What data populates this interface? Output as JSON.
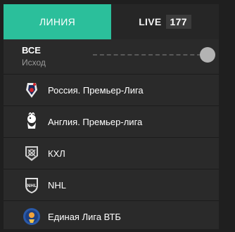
{
  "tabs": {
    "line_label": "ЛИНИЯ",
    "live_label": "LIVE",
    "live_count": "177"
  },
  "filter": {
    "title": "ВСЕ",
    "subtitle": "Исход"
  },
  "leagues": [
    {
      "name": "Россия. Премьер-Лига",
      "icon": "russian-premier-league-icon"
    },
    {
      "name": "Англия. Премьер-лига",
      "icon": "english-premier-league-icon"
    },
    {
      "name": "КХЛ",
      "icon": "khl-icon"
    },
    {
      "name": "NHL",
      "icon": "nhl-icon"
    },
    {
      "name": "Единая Лига ВТБ",
      "icon": "vtb-united-league-icon"
    }
  ],
  "colors": {
    "accent": "#2bbf9b",
    "panel": "#2a2a2a",
    "background": "#1f1f1f"
  }
}
